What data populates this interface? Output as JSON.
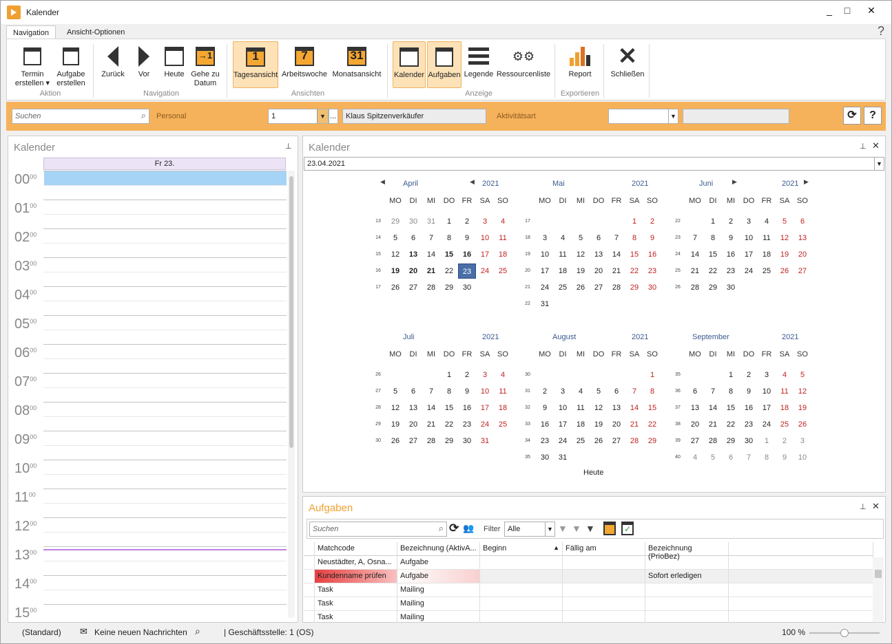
{
  "window": {
    "title": "Kalender",
    "controls": [
      "_",
      "□",
      "✕"
    ]
  },
  "ribbon": {
    "tabs": [
      "Navigation",
      "Ansicht-Optionen"
    ],
    "help": "?",
    "buttons": {
      "termin": "Termin\nerstellen ▾",
      "aufgabe": "Aufgabe\nerstellen",
      "zurueck": "Zurück",
      "vor": "Vor",
      "heute": "Heute",
      "gehe": "Gehe zu\nDatum",
      "tag": "Tagesansicht",
      "arbeit": "Arbeitswoche",
      "monat": "Monatsansicht",
      "kalender": "Kalender",
      "aufgaben": "Aufgaben",
      "legende": "Legende",
      "ressourcen": "Ressourcenliste",
      "report": "Report",
      "schliessen": "Schließen"
    },
    "icons": {
      "tag": "1",
      "arbeit": "7",
      "monat": "31"
    },
    "groups": {
      "aktion": "Aktion",
      "navigation": "Navigation",
      "ansichten": "Ansichten",
      "anzeige": "Anzeige",
      "exportieren": "Exportieren"
    }
  },
  "filter": {
    "search_placeholder": "Suchen",
    "personal_label": "Personal",
    "personal_value": "1",
    "personal_name": "Klaus Spitzenverkäufer",
    "aktivitaet_label": "Aktivitätsart",
    "aktivitaet_value": "",
    "refresh": "⟳",
    "help": "?"
  },
  "dayview": {
    "title": "Kalender",
    "day_header": "Fr 23.",
    "hours": [
      "00",
      "01",
      "02",
      "03",
      "04",
      "05",
      "06",
      "07",
      "08",
      "09",
      "10",
      "11",
      "12",
      "13",
      "14",
      "15"
    ],
    "minute_suffix": "00"
  },
  "calendar": {
    "title": "Kalender",
    "date": "23.04.2021",
    "today_button": "Heute",
    "dow": [
      "MO",
      "DI",
      "MI",
      "DO",
      "FR",
      "SA",
      "SO"
    ],
    "months": [
      {
        "name": "April",
        "year": "2021",
        "weeks": [
          {
            "wk": "13",
            "days": [
              "29",
              "30",
              "31",
              "1",
              "2",
              "3",
              "4"
            ],
            "other": [
              0,
              1,
              2
            ]
          },
          {
            "wk": "14",
            "days": [
              "5",
              "6",
              "7",
              "8",
              "9",
              "10",
              "11"
            ]
          },
          {
            "wk": "15",
            "days": [
              "12",
              "13",
              "14",
              "15",
              "16",
              "17",
              "18"
            ],
            "bold": [
              1,
              3,
              4
            ]
          },
          {
            "wk": "16",
            "days": [
              "19",
              "20",
              "21",
              "22",
              "23",
              "24",
              "25"
            ],
            "bold": [
              0,
              1,
              2
            ],
            "today": 4
          },
          {
            "wk": "17",
            "days": [
              "26",
              "27",
              "28",
              "29",
              "30",
              "",
              ""
            ]
          }
        ]
      },
      {
        "name": "Mai",
        "year": "2021",
        "weeks": [
          {
            "wk": "17",
            "days": [
              "",
              "",
              "",
              "",
              "",
              "1",
              "2"
            ]
          },
          {
            "wk": "18",
            "days": [
              "3",
              "4",
              "5",
              "6",
              "7",
              "8",
              "9"
            ]
          },
          {
            "wk": "19",
            "days": [
              "10",
              "11",
              "12",
              "13",
              "14",
              "15",
              "16"
            ]
          },
          {
            "wk": "20",
            "days": [
              "17",
              "18",
              "19",
              "20",
              "21",
              "22",
              "23"
            ]
          },
          {
            "wk": "21",
            "days": [
              "24",
              "25",
              "26",
              "27",
              "28",
              "29",
              "30"
            ]
          },
          {
            "wk": "22",
            "days": [
              "31",
              "",
              "",
              "",
              "",
              "",
              ""
            ]
          }
        ]
      },
      {
        "name": "Juni",
        "year": "2021",
        "weeks": [
          {
            "wk": "22",
            "days": [
              "",
              "1",
              "2",
              "3",
              "4",
              "5",
              "6"
            ]
          },
          {
            "wk": "23",
            "days": [
              "7",
              "8",
              "9",
              "10",
              "11",
              "12",
              "13"
            ]
          },
          {
            "wk": "24",
            "days": [
              "14",
              "15",
              "16",
              "17",
              "18",
              "19",
              "20"
            ]
          },
          {
            "wk": "25",
            "days": [
              "21",
              "22",
              "23",
              "24",
              "25",
              "26",
              "27"
            ]
          },
          {
            "wk": "26",
            "days": [
              "28",
              "29",
              "30",
              "",
              "",
              "",
              ""
            ]
          }
        ]
      },
      {
        "name": "Juli",
        "year": "2021",
        "weeks": [
          {
            "wk": "26",
            "days": [
              "",
              "",
              "",
              "1",
              "2",
              "3",
              "4"
            ]
          },
          {
            "wk": "27",
            "days": [
              "5",
              "6",
              "7",
              "8",
              "9",
              "10",
              "11"
            ]
          },
          {
            "wk": "28",
            "days": [
              "12",
              "13",
              "14",
              "15",
              "16",
              "17",
              "18"
            ]
          },
          {
            "wk": "29",
            "days": [
              "19",
              "20",
              "21",
              "22",
              "23",
              "24",
              "25"
            ]
          },
          {
            "wk": "30",
            "days": [
              "26",
              "27",
              "28",
              "29",
              "30",
              "31",
              ""
            ]
          }
        ]
      },
      {
        "name": "August",
        "year": "2021",
        "weeks": [
          {
            "wk": "30",
            "days": [
              "",
              "",
              "",
              "",
              "",
              "",
              "1"
            ]
          },
          {
            "wk": "31",
            "days": [
              "2",
              "3",
              "4",
              "5",
              "6",
              "7",
              "8"
            ]
          },
          {
            "wk": "32",
            "days": [
              "9",
              "10",
              "11",
              "12",
              "13",
              "14",
              "15"
            ]
          },
          {
            "wk": "33",
            "days": [
              "16",
              "17",
              "18",
              "19",
              "20",
              "21",
              "22"
            ]
          },
          {
            "wk": "34",
            "days": [
              "23",
              "24",
              "25",
              "26",
              "27",
              "28",
              "29"
            ]
          },
          {
            "wk": "35",
            "days": [
              "30",
              "31",
              "",
              "",
              "",
              "",
              ""
            ]
          }
        ]
      },
      {
        "name": "September",
        "year": "2021",
        "weeks": [
          {
            "wk": "35",
            "days": [
              "",
              "",
              "1",
              "2",
              "3",
              "4",
              "5"
            ]
          },
          {
            "wk": "36",
            "days": [
              "6",
              "7",
              "8",
              "9",
              "10",
              "11",
              "12"
            ]
          },
          {
            "wk": "37",
            "days": [
              "13",
              "14",
              "15",
              "16",
              "17",
              "18",
              "19"
            ]
          },
          {
            "wk": "38",
            "days": [
              "20",
              "21",
              "22",
              "23",
              "24",
              "25",
              "26"
            ]
          },
          {
            "wk": "39",
            "days": [
              "27",
              "28",
              "29",
              "30",
              "1",
              "2",
              "3"
            ],
            "other": [
              4,
              5,
              6
            ]
          },
          {
            "wk": "40",
            "days": [
              "4",
              "5",
              "6",
              "7",
              "8",
              "9",
              "10"
            ],
            "other": [
              0,
              1,
              2,
              3,
              4,
              5,
              6
            ]
          }
        ]
      }
    ]
  },
  "tasks": {
    "title": "Aufgaben",
    "search_placeholder": "Suchen",
    "filter_label": "Filter",
    "filter_value": "Alle",
    "columns": [
      "Matchcode",
      "Bezeichnung (AktivA...",
      "Beginn",
      "Fällig am",
      "Bezeichnung (PrioBez)"
    ],
    "rows": [
      [
        "Neustädter, A, Osna...",
        "Aufgabe",
        "",
        "",
        ""
      ],
      [
        "Kundenname prüfen",
        "Aufgabe",
        "",
        "",
        "Sofort erledigen"
      ],
      [
        "Task",
        "Mailing",
        "",
        "",
        ""
      ],
      [
        "Task",
        "Mailing",
        "",
        "",
        ""
      ],
      [
        "Task",
        "Mailing",
        "",
        "",
        ""
      ]
    ]
  },
  "status": {
    "profile": "(Standard)",
    "messages": "Keine neuen Nachrichten",
    "branch": "| Geschäftsstelle:  1 (OS)",
    "zoom": "100 %",
    "zoom_level": 0.5
  },
  "colors": {
    "accent": "#f6b25a",
    "selected": "#4a6ea8",
    "weekend": "#c02020",
    "highlight_task": "#e84040"
  }
}
